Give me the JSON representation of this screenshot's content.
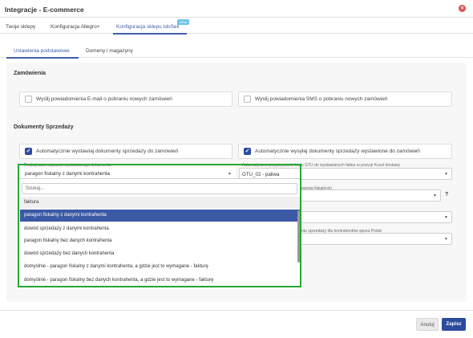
{
  "window": {
    "title": "Integracje - E-commerce"
  },
  "tabs": [
    {
      "label": "Twoje sklepy"
    },
    {
      "label": "Konfiguracja Allegro+"
    },
    {
      "label": "Konfiguracja sklepu IdoSell",
      "badge": "NEW"
    }
  ],
  "subtabs": [
    {
      "label": "Ustawienia podstawowe"
    },
    {
      "label": "Domeny i magazyny"
    }
  ],
  "orders": {
    "title": "Zamówienia",
    "email_notify": "Wyślij powiadomienia E-mail o pobraniu nowych zamówień",
    "sms_notify": "Wyślij powiadomienia SMS o pobraniu nowych zamówień"
  },
  "sales_docs": {
    "title": "Dokumenty Sprzedaży",
    "auto_issue": "Automatycznie wystawiaj dokumenty sprzedaży do zamówień",
    "auto_send": "Automatycznie wysyłaj dokumenty sprzedaży wystawione do zamówień",
    "doc_type_label": "Rodzaj automatycznie wystawianego dokumentu",
    "doc_type_value": "paragon fiskalny z danymi kontrahenta",
    "gtu_label": "Automatyczne przypisywanie kodu GTU do wystawianych faktur w pozycji Koszt dostawy",
    "gtu_value": "GTU_02 - paliwa",
    "fiscal_label_fragment": "gonów fiskalnych",
    "foreign_label_fragment": "ntu sprzedaży dla kontrahentów spoza Polski",
    "help_symbol": "?"
  },
  "dropdown": {
    "search_placeholder": "Szukaj...",
    "options": [
      "faktura",
      "paragon fiskalny z danymi kontrahenta",
      "dowód sprzedaży z danymi kontrahenta",
      "paragon fiskalny bez danych kontrahenta",
      "dowód sprzedaży bez danych kontrahenta",
      "domyślnie - paragon fiskalny z danymi kontrahenta, a gdzie jest to wymagane - fakturę",
      "domyślnie - paragon fiskalny bez danych kontrahenta, a gdzie jest to wymagane - fakturę"
    ]
  },
  "footer": {
    "cancel_label": "Anuluj",
    "save_label": "Zapisz"
  },
  "colors": {
    "accent": "#2c4b9e",
    "highlight": "#26a834",
    "close": "#d9534f"
  }
}
